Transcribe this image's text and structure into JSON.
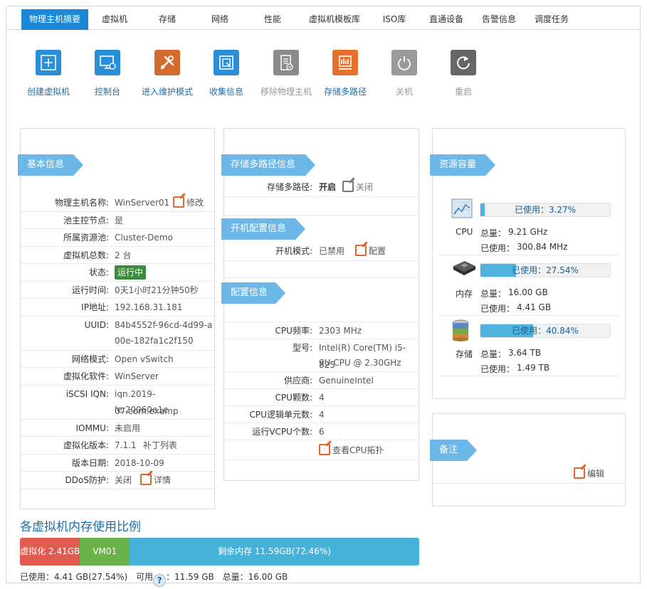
{
  "tabs": [
    {
      "label": "物理主机摘要",
      "active": true
    },
    {
      "label": "虚拟机"
    },
    {
      "label": "存储"
    },
    {
      "label": "网络"
    },
    {
      "label": "性能"
    },
    {
      "label": "虚拟机模板库"
    },
    {
      "label": "ISO库"
    },
    {
      "label": "直通设备"
    },
    {
      "label": "告警信息"
    },
    {
      "label": "调度任务"
    }
  ],
  "toolbar": [
    {
      "label": "创建虚拟机",
      "icon": "plus-icon",
      "color": "#2a8fd8"
    },
    {
      "label": "控制台",
      "icon": "monitor-icon",
      "color": "#2a8fd8"
    },
    {
      "label": "进入维护模式",
      "icon": "tools-icon",
      "color": "#d26b2d"
    },
    {
      "label": "收集信息",
      "icon": "collect-icon",
      "color": "#2a8fd8"
    },
    {
      "label": "移除物理主机",
      "icon": "server-remove-icon",
      "color": "#8a8a8a"
    },
    {
      "label": "存储多路径",
      "icon": "storage-icon",
      "color": "#e8702d"
    },
    {
      "label": "关机",
      "icon": "power-icon",
      "color": "#9a9a9a"
    },
    {
      "label": "重启",
      "icon": "restart-icon",
      "color": "#666666"
    }
  ],
  "basic": {
    "title": "基本信息",
    "rows": [
      {
        "k": "物理主机名称:",
        "v": "WinServer01",
        "action": "修改"
      },
      {
        "k": "池主控节点:",
        "v": "是"
      },
      {
        "k": "所属资源池:",
        "v": "Cluster-Demo"
      },
      {
        "k": "虚拟机总数:",
        "v": "2 台"
      },
      {
        "k": "状态:",
        "v": "运行中"
      },
      {
        "k": "运行时间:",
        "v": "0天1小时21分钟50秒"
      },
      {
        "k": "IP地址:",
        "v": "192.168.31.181"
      },
      {
        "k": "UUID:",
        "v": "84b4552f-96cd-4d99-a",
        "v2": "00e-182fa1c2f150"
      },
      {
        "k": "网络模式:",
        "v": "Open vSwitch"
      },
      {
        "k": "虚拟化软件:",
        "v": "WinServer"
      },
      {
        "k": "iSCSI IQN:",
        "v": "iqn.2019-07.com.examp",
        "v2": "le:20060e1e"
      },
      {
        "k": "IOMMU:",
        "v": "未启用"
      },
      {
        "k": "虚拟化版本:",
        "v": "7.1.1",
        "action": "补丁列表"
      },
      {
        "k": "版本日期:",
        "v": "2018-10-09"
      },
      {
        "k": "DDoS防护:",
        "v": "关闭",
        "action": "详情"
      }
    ]
  },
  "multipath": {
    "title": "存储多路径信息",
    "k": "存储多路径:",
    "on": "开启",
    "off": "关闭"
  },
  "boot": {
    "title": "开机配置信息",
    "k": "开机模式:",
    "v": "已禁用",
    "action": "配置"
  },
  "config": {
    "title": "配置信息",
    "rows": [
      {
        "k": "CPU频率:",
        "v": "2303 MHz"
      },
      {
        "k": "型号:",
        "v": "Intel(R) Core(TM) i5-825",
        "v2": "9U CPU @ 2.30GHz"
      },
      {
        "k": "供应商:",
        "v": "GenuineIntel"
      },
      {
        "k": "CPU颗数:",
        "v": "4"
      },
      {
        "k": "CPU逻辑单元数:",
        "v": "4"
      },
      {
        "k": "运行VCPU个数:",
        "v": "6"
      }
    ],
    "action": "查看CPU拓扑"
  },
  "resource": {
    "title": "资源容量",
    "items": [
      {
        "name": "CPU",
        "icon": "cpu-chart-icon",
        "percent": 3.27,
        "used_label": "已使用：3.27%",
        "total_label": "总量：",
        "total": "9.21 GHz",
        "usedk": "已使用：",
        "used": "300.84 MHz"
      },
      {
        "name": "内存",
        "icon": "memory-chip-icon",
        "percent": 27.54,
        "used_label": "已使用：27.54%",
        "total_label": "总量：",
        "total": "16.00 GB",
        "usedk": "已使用：",
        "used": "4.41 GB"
      },
      {
        "name": "存储",
        "icon": "database-icon",
        "percent": 40.84,
        "used_label": "已使用：40.84%",
        "total_label": "总量：",
        "total": "3.64 TB",
        "usedk": "已使用：",
        "used": "1.49 TB"
      }
    ]
  },
  "notes": {
    "title": "备注",
    "action": "编辑"
  },
  "memory": {
    "title": "各虚拟机内存使用比例",
    "segments": [
      {
        "label": "虚拟化 2.41GB",
        "fraction": 0.1506,
        "color": "#e05b52"
      },
      {
        "label": "VM01",
        "fraction": 0.124,
        "color": "#6bb14a"
      },
      {
        "label": "剩余内存 11.59GB(72.46%)",
        "fraction": 0.7254,
        "color": "#46b2da"
      }
    ],
    "summary": {
      "used_k": "已使用：",
      "used": "4.41 GB(27.54%)",
      "avail_k": "可用",
      "help": "?",
      "avail": "：11.59 GB",
      "total_k": "总量：",
      "total": "16.00 GB"
    }
  }
}
